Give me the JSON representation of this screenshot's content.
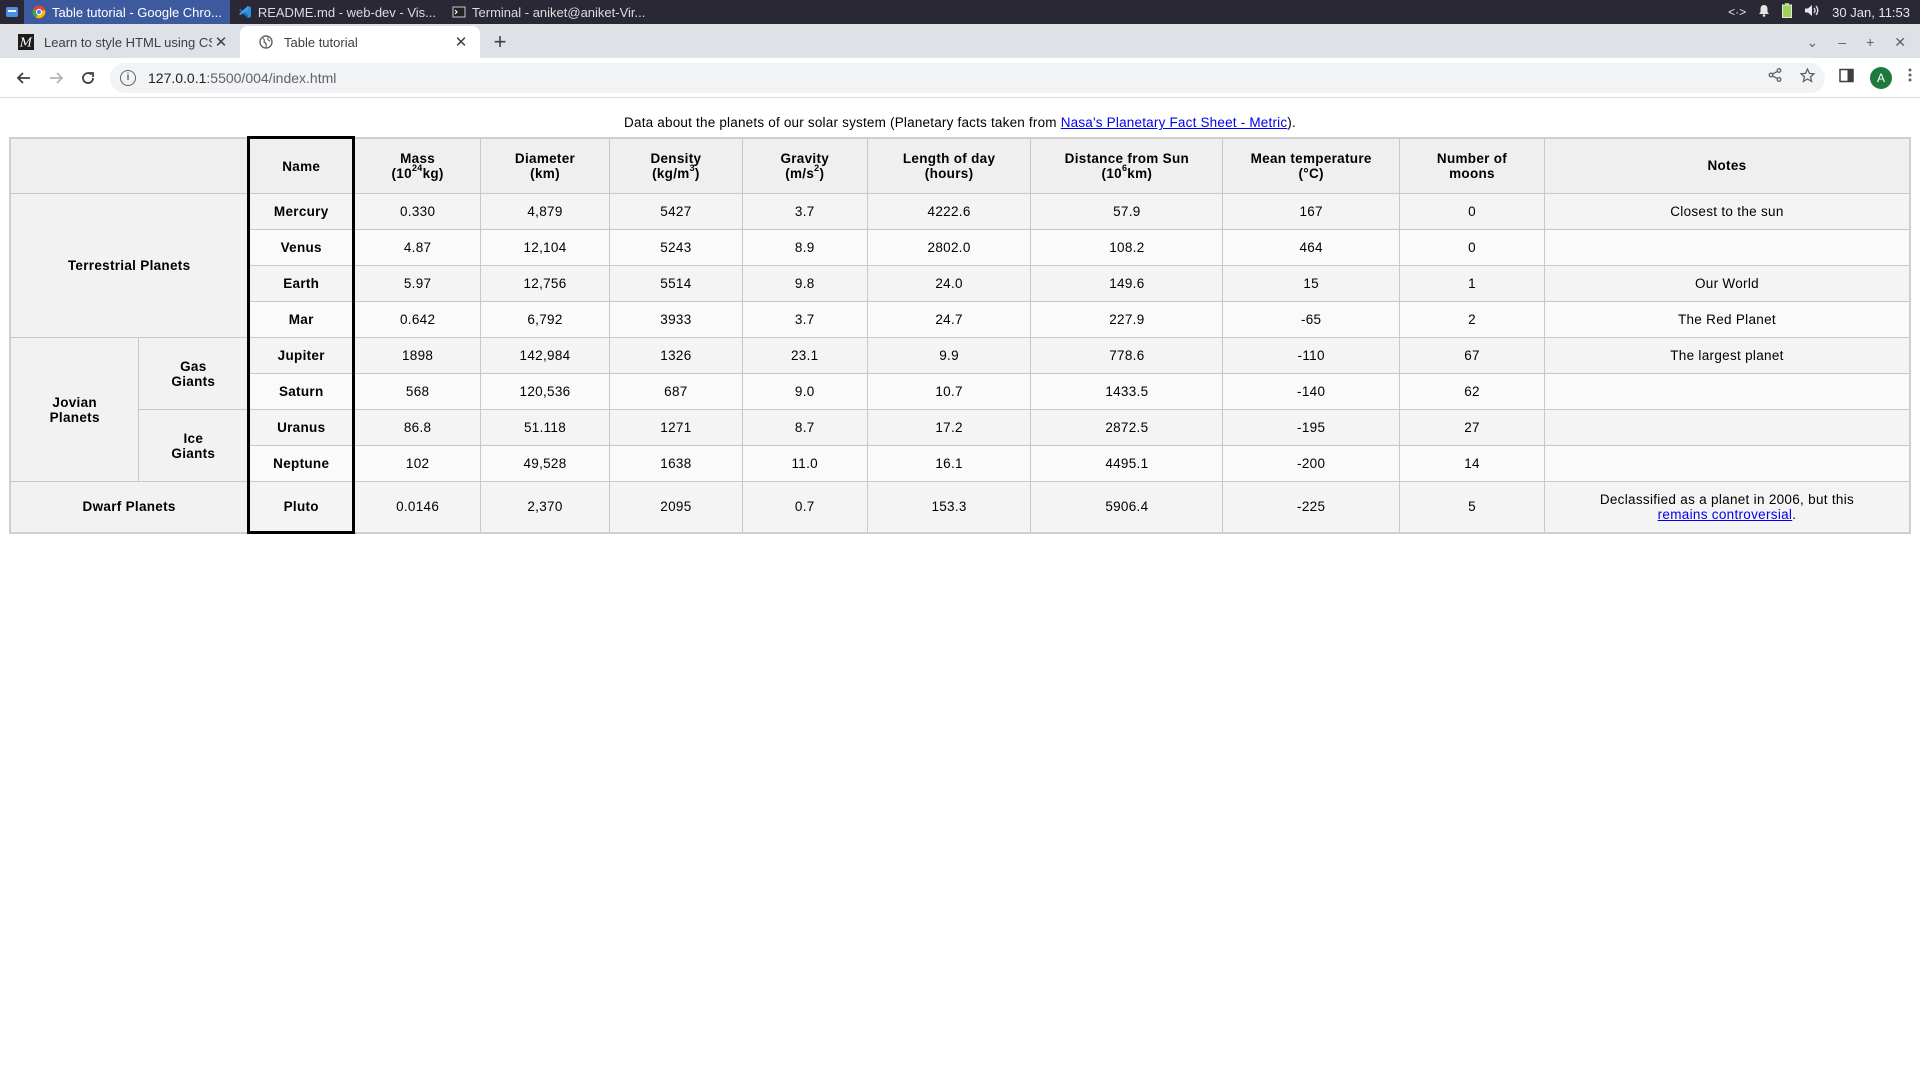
{
  "taskbar": {
    "tasks": [
      {
        "label": "Table tutorial - Google Chro..."
      },
      {
        "label": "README.md - web-dev - Vis..."
      },
      {
        "label": "Terminal - aniket@aniket-Vir..."
      }
    ],
    "datetime": "30 Jan, 11:53"
  },
  "browser": {
    "tabs": [
      {
        "title": "Learn to style HTML using CSS",
        "favicon": "M"
      },
      {
        "title": "Table tutorial"
      }
    ],
    "url_host": "127.0.0.1",
    "url_path": ":5500/004/index.html",
    "profile_initial": "A"
  },
  "page": {
    "caption_prefix": "Data about the planets of our solar system (Planetary facts taken from ",
    "caption_link": "Nasa's Planetary Fact Sheet - Metric",
    "caption_suffix": ").",
    "headers": {
      "name": "Name",
      "mass_a": "Mass",
      "mass_b": "(10",
      "mass_sup": "24",
      "mass_c": "kg)",
      "diameter_a": "Diameter",
      "diameter_b": "(km)",
      "density_a": "Density",
      "density_b": "(kg/m",
      "density_sup": "3",
      "density_c": ")",
      "gravity_a": "Gravity",
      "gravity_b": "(m/s",
      "gravity_sup": "2",
      "gravity_c": ")",
      "day_a": "Length of day",
      "day_b": "(hours)",
      "dist_a": "Distance from Sun",
      "dist_b": "(10",
      "dist_sup": "6",
      "dist_c": "km)",
      "temp_a": "Mean temperature",
      "temp_b": "(°C)",
      "moons_a": "Number of",
      "moons_b": "moons",
      "notes": "Notes"
    },
    "groups": {
      "terrestrial": "Terrestrial Planets",
      "jovian_a": "Jovian",
      "jovian_b": "Planets",
      "gas_a": "Gas",
      "gas_b": "Giants",
      "ice_a": "Ice",
      "ice_b": "Giants",
      "dwarf": "Dwarf Planets"
    },
    "rows": [
      {
        "name": "Mercury",
        "mass": "0.330",
        "diameter": "4,879",
        "density": "5427",
        "gravity": "3.7",
        "day": "4222.6",
        "distance": "57.9",
        "temp": "167",
        "moons": "0",
        "notes": "Closest to the sun"
      },
      {
        "name": "Venus",
        "mass": "4.87",
        "diameter": "12,104",
        "density": "5243",
        "gravity": "8.9",
        "day": "2802.0",
        "distance": "108.2",
        "temp": "464",
        "moons": "0",
        "notes": ""
      },
      {
        "name": "Earth",
        "mass": "5.97",
        "diameter": "12,756",
        "density": "5514",
        "gravity": "9.8",
        "day": "24.0",
        "distance": "149.6",
        "temp": "15",
        "moons": "1",
        "notes": "Our World"
      },
      {
        "name": "Mar",
        "mass": "0.642",
        "diameter": "6,792",
        "density": "3933",
        "gravity": "3.7",
        "day": "24.7",
        "distance": "227.9",
        "temp": "-65",
        "moons": "2",
        "notes": "The Red Planet"
      },
      {
        "name": "Jupiter",
        "mass": "1898",
        "diameter": "142,984",
        "density": "1326",
        "gravity": "23.1",
        "day": "9.9",
        "distance": "778.6",
        "temp": "-110",
        "moons": "67",
        "notes": "The largest planet"
      },
      {
        "name": "Saturn",
        "mass": "568",
        "diameter": "120,536",
        "density": "687",
        "gravity": "9.0",
        "day": "10.7",
        "distance": "1433.5",
        "temp": "-140",
        "moons": "62",
        "notes": ""
      },
      {
        "name": "Uranus",
        "mass": "86.8",
        "diameter": "51.118",
        "density": "1271",
        "gravity": "8.7",
        "day": "17.2",
        "distance": "2872.5",
        "temp": "-195",
        "moons": "27",
        "notes": ""
      },
      {
        "name": "Neptune",
        "mass": "102",
        "diameter": "49,528",
        "density": "1638",
        "gravity": "11.0",
        "day": "16.1",
        "distance": "4495.1",
        "temp": "-200",
        "moons": "14",
        "notes": ""
      },
      {
        "name": "Pluto",
        "mass": "0.0146",
        "diameter": "2,370",
        "density": "2095",
        "gravity": "0.7",
        "day": "153.3",
        "distance": "5906.4",
        "temp": "-225",
        "moons": "5",
        "notes": "Declassified as a planet in 2006, but this",
        "notes_link": "remains controversial",
        "notes_suffix": "."
      }
    ]
  }
}
